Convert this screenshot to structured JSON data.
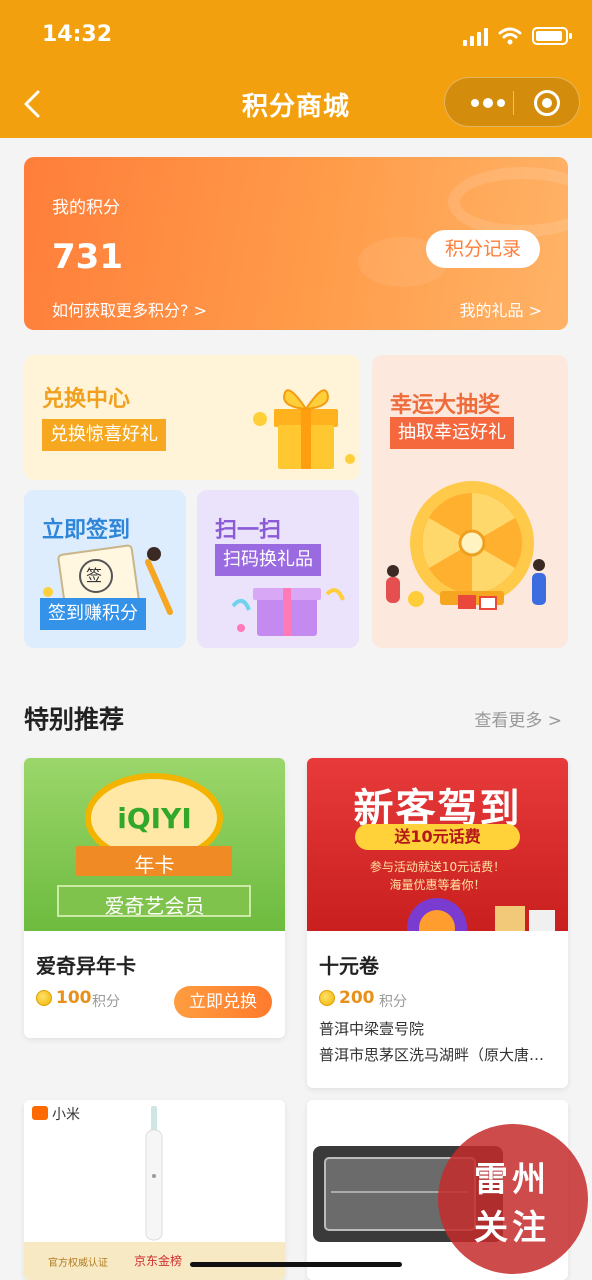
{
  "status_bar": {
    "time": "14:32"
  },
  "nav": {
    "title": "积分商城"
  },
  "points_card": {
    "label": "我的积分",
    "value": "731",
    "record_button": "积分记录",
    "how_to_link": "如何获取更多积分? >",
    "my_gifts_link": "我的礼品 >"
  },
  "tiles": {
    "exchange": {
      "title": "兑换中心",
      "tag": "兑换惊喜好礼"
    },
    "lucky": {
      "title": "幸运大抽奖",
      "tag": "抽取幸运好礼"
    },
    "signin": {
      "title": "立即签到",
      "tag": "签到赚积分",
      "stamp_char": "签"
    },
    "scan": {
      "title": "扫一扫",
      "tag": "扫码换礼品"
    }
  },
  "section": {
    "title": "特别推荐",
    "more": "查看更多 >"
  },
  "products": [
    {
      "banner_logo": "iQIYI",
      "banner_ribbon": "年卡",
      "banner_sub": "爱奇艺会员",
      "name": "爱奇异年卡",
      "price": "100",
      "unit": "积分",
      "button": "立即兑换"
    },
    {
      "banner_headline": "新客驾到",
      "banner_ribbon": "送10元话费",
      "banner_sub1": "参与活动就送10元话费！",
      "banner_sub2": "海量优惠等着你！",
      "name": "十元卷",
      "price": "200",
      "unit": "积分",
      "address_name": "普洱中梁壹号院",
      "address_detail": "普洱市思茅区洗马湖畔（原大唐…"
    },
    {
      "brand": "小米",
      "footer1": "官方权威认证",
      "footer2": "京东金榜"
    },
    {}
  ],
  "watermark": {
    "line1": "雷州",
    "line2": "关注"
  },
  "colors": {
    "header": "#f2a00e",
    "accent": "#ff7e3a",
    "price": "#e8901a"
  }
}
